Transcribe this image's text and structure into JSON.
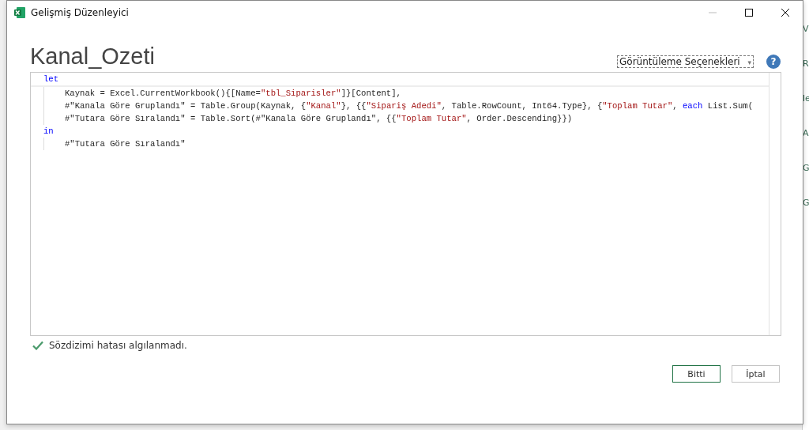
{
  "window": {
    "title": "Gelişmiş Düzenleyici"
  },
  "query_name": "Kanal_Ozeti",
  "view_options": {
    "label": "Görüntüleme Seçenekleri",
    "caret": "▾"
  },
  "help": {
    "label": "?"
  },
  "code_lines": [
    {
      "indented": false,
      "tokens": [
        {
          "kind": "keyword",
          "text": "let"
        }
      ]
    },
    {
      "indented": true,
      "tokens": [
        {
          "kind": "plain",
          "text": "Kaynak = Excel.CurrentWorkbook(){[Name="
        },
        {
          "kind": "string",
          "text": "\"tbl_Siparisler\""
        },
        {
          "kind": "plain",
          "text": "]}[Content],"
        }
      ]
    },
    {
      "indented": true,
      "tokens": [
        {
          "kind": "plain",
          "text": "#\"Kanala Göre Gruplandı\" = Table.Group(Kaynak, {"
        },
        {
          "kind": "string",
          "text": "\"Kanal\""
        },
        {
          "kind": "plain",
          "text": "}, {{"
        },
        {
          "kind": "string",
          "text": "\"Sipariş Adedi\""
        },
        {
          "kind": "plain",
          "text": ", Table.RowCount, Int64.Type}, {"
        },
        {
          "kind": "string",
          "text": "\"Toplam Tutar\""
        },
        {
          "kind": "plain",
          "text": ", "
        },
        {
          "kind": "keyword",
          "text": "each"
        },
        {
          "kind": "plain",
          "text": " List.Sum("
        }
      ]
    },
    {
      "indented": true,
      "tokens": [
        {
          "kind": "plain",
          "text": "#\"Tutara Göre Sıralandı\" = Table.Sort(#\"Kanala Göre Gruplandı\", {{"
        },
        {
          "kind": "string",
          "text": "\"Toplam Tutar\""
        },
        {
          "kind": "plain",
          "text": ", Order.Descending}})"
        }
      ]
    },
    {
      "indented": false,
      "tokens": [
        {
          "kind": "keyword",
          "text": "in"
        }
      ]
    },
    {
      "indented": true,
      "tokens": [
        {
          "kind": "plain",
          "text": "#\"Tutara Göre Sıralandı\""
        }
      ]
    }
  ],
  "status": {
    "ok": true,
    "text": "Sözdizimi hatası algılanmadı."
  },
  "buttons": [
    {
      "label": "Bitti",
      "primary": true
    },
    {
      "label": "İptal",
      "primary": false
    }
  ],
  "background_fragments": [
    "V",
    "R",
    "le",
    "A",
    "G",
    "G"
  ]
}
